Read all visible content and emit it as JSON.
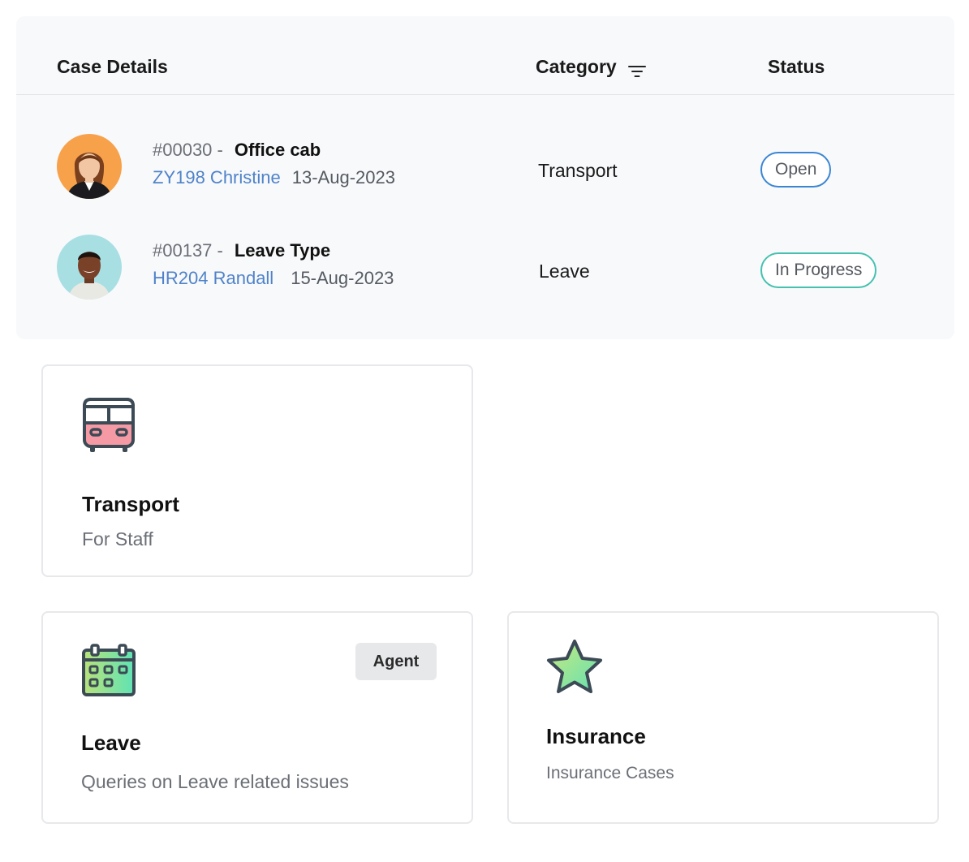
{
  "table": {
    "headers": {
      "case_details": "Case Details",
      "category": "Category",
      "status": "Status"
    },
    "rows": [
      {
        "case_id": "#00030 -",
        "title": "Office cab",
        "user": "ZY198 Christine",
        "date": "13-Aug-2023",
        "category": "Transport",
        "status": "Open",
        "status_color": "#3b86d4"
      },
      {
        "case_id": "#00137 -",
        "title": "Leave Type",
        "user": "HR204 Randall",
        "date": "15-Aug-2023",
        "category": "Leave",
        "status": "In Progress",
        "status_color": "#46c1b0"
      }
    ]
  },
  "cards": {
    "transport": {
      "icon": "bus-icon",
      "title": "Transport",
      "subtitle": "For Staff"
    },
    "leave": {
      "icon": "calendar-icon",
      "title": "Leave",
      "subtitle": "Queries on Leave related issues",
      "tag": "Agent"
    },
    "insurance": {
      "icon": "star-icon",
      "title": "Insurance",
      "subtitle": "Insurance Cases"
    }
  },
  "colors": {
    "link": "#4f83c9",
    "avatar_1_bg": "#f7a24a",
    "avatar_2_bg": "#a8dfe3"
  }
}
